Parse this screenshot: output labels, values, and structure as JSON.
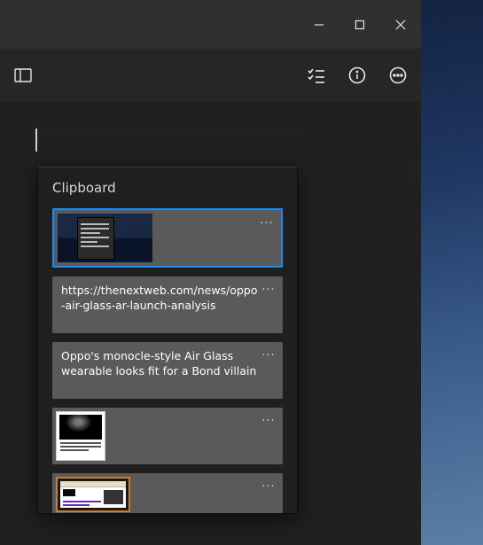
{
  "window": {
    "minimize_label": "Minimize",
    "maximize_label": "Maximize",
    "close_label": "Close"
  },
  "toolbar": {
    "sidebar_toggle": "Toggle sidebar",
    "checklist": "Checklist",
    "info": "Info",
    "more": "More"
  },
  "clipboard": {
    "title": "Clipboard",
    "items": [
      {
        "type": "image",
        "alt": "Screenshot: dark context menu on desktop",
        "selected": true
      },
      {
        "type": "text",
        "text": "https://thenextweb.com/news/oppo-air-glass-ar-launch-analysis"
      },
      {
        "type": "text",
        "text": "Oppo's monocle-style Air Glass wearable looks fit for a Bond villain"
      },
      {
        "type": "image",
        "alt": "Article clipping with dark product photo"
      },
      {
        "type": "image",
        "alt": "Browser screenshot: TNW article page"
      }
    ],
    "more_label": "More options"
  }
}
